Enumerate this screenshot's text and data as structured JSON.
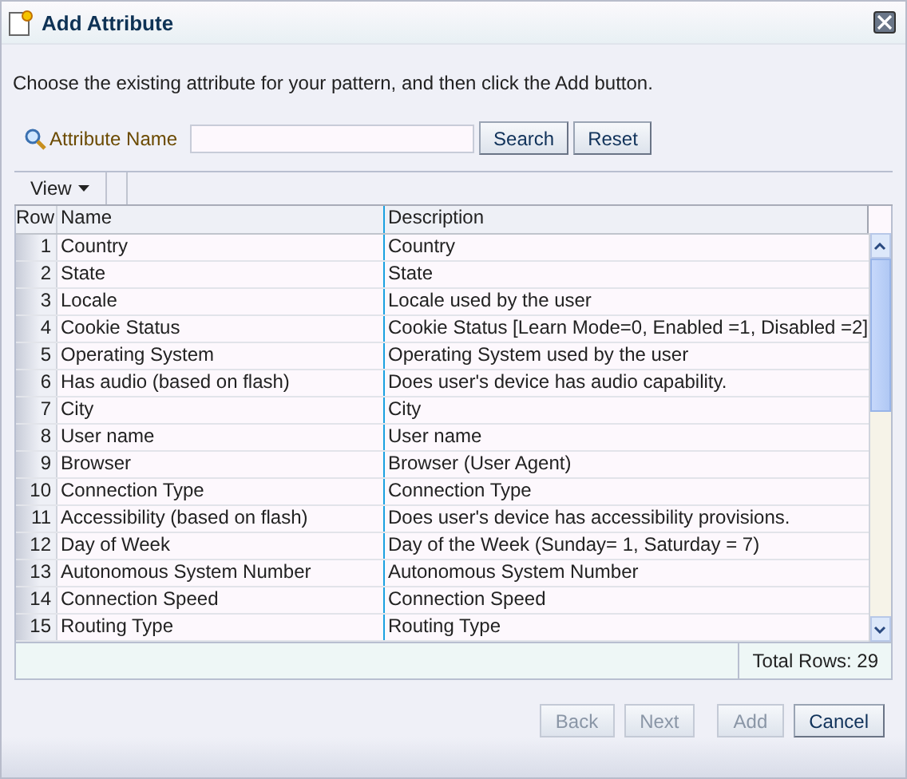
{
  "window": {
    "title": "Add Attribute"
  },
  "instruction": "Choose the existing attribute for your pattern, and then click the Add button.",
  "search": {
    "label": "Attribute Name",
    "buttons": [
      {
        "label": "Search",
        "disabled": false
      },
      {
        "label": "Reset",
        "disabled": false
      }
    ]
  },
  "toolbar": {
    "view_menu": "View"
  },
  "table": {
    "columns": [
      "Row",
      "Name",
      "Description"
    ],
    "rows": [
      {
        "row": "1",
        "name": "Country",
        "description": "Country"
      },
      {
        "row": "2",
        "name": "State",
        "description": "State"
      },
      {
        "row": "3",
        "name": "Locale",
        "description": "Locale used by the user"
      },
      {
        "row": "4",
        "name": "Cookie Status",
        "description": "Cookie Status [Learn Mode=0, Enabled =1, Disabled =2]"
      },
      {
        "row": "5",
        "name": "Operating System",
        "description": "Operating System used by the user"
      },
      {
        "row": "6",
        "name": "Has audio (based on flash)",
        "description": "Does user's device has audio capability."
      },
      {
        "row": "7",
        "name": "City",
        "description": "City"
      },
      {
        "row": "8",
        "name": "User name",
        "description": "User name"
      },
      {
        "row": "9",
        "name": "Browser",
        "description": "Browser (User Agent)"
      },
      {
        "row": "10",
        "name": "Connection Type",
        "description": "Connection Type"
      },
      {
        "row": "11",
        "name": "Accessibility (based on flash)",
        "description": "Does user's device has accessibility provisions."
      },
      {
        "row": "12",
        "name": "Day of Week",
        "description": "Day of the Week (Sunday= 1, Saturday = 7)"
      },
      {
        "row": "13",
        "name": "Autonomous System Number",
        "description": "Autonomous System Number"
      },
      {
        "row": "14",
        "name": "Connection Speed",
        "description": "Connection Speed"
      },
      {
        "row": "15",
        "name": "Routing Type",
        "description": "Routing Type"
      }
    ],
    "total": "Total Rows: 29"
  },
  "buttons": [
    {
      "label": "Back",
      "disabled": true
    },
    {
      "label": "Next",
      "disabled": true
    },
    {
      "label": "Add",
      "disabled": true
    },
    {
      "label": "Cancel",
      "disabled": false
    }
  ]
}
